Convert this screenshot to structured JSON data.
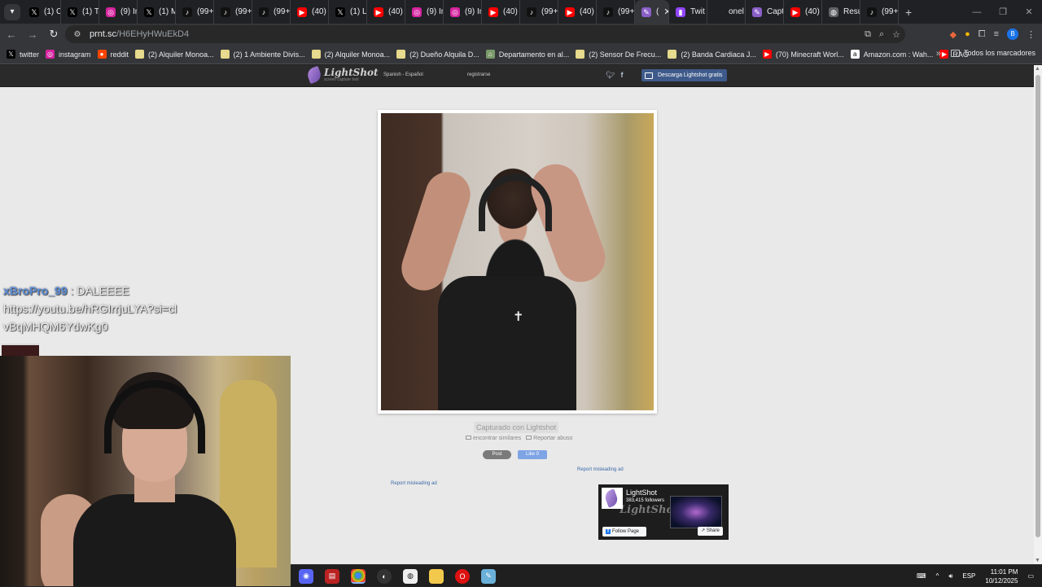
{
  "browser": {
    "tabs": [
      {
        "icon": "x-icon",
        "label": "(1) C"
      },
      {
        "icon": "x-icon",
        "label": "(1) Tr"
      },
      {
        "icon": "instagram-icon",
        "label": "(9) In"
      },
      {
        "icon": "x-icon",
        "label": "(1) M"
      },
      {
        "icon": "tiktok-icon",
        "label": "(99+"
      },
      {
        "icon": "tiktok-icon",
        "label": "(99+"
      },
      {
        "icon": "tiktok-icon",
        "label": "(99+"
      },
      {
        "icon": "youtube-icon",
        "label": "(40)"
      },
      {
        "icon": "x-icon",
        "label": "(1) L"
      },
      {
        "icon": "youtube-icon",
        "label": "(40)"
      },
      {
        "icon": "instagram-icon",
        "label": "(9) In"
      },
      {
        "icon": "instagram-icon",
        "label": "(9) In"
      },
      {
        "icon": "youtube-icon",
        "label": "(40)"
      },
      {
        "icon": "tiktok-icon",
        "label": "(99+"
      },
      {
        "icon": "youtube-icon",
        "label": "(40)"
      },
      {
        "icon": "tiktok-icon",
        "label": "(99+"
      },
      {
        "icon": "lightshot-icon",
        "label": "(",
        "active": true
      },
      {
        "icon": "twitch-icon",
        "label": "Twit"
      },
      {
        "icon": "blank-icon",
        "label": "onel"
      },
      {
        "icon": "lightshot-icon",
        "label": "Capt"
      },
      {
        "icon": "youtube-icon",
        "label": "(40)"
      },
      {
        "icon": "globe-icon",
        "label": "Resu"
      },
      {
        "icon": "tiktok-icon",
        "label": "(99+"
      }
    ],
    "url_host": "prnt.sc",
    "url_path": "/H6EHyHWuEkD4",
    "profile_letter": "B",
    "bookmarks": [
      {
        "icon": "x-icon",
        "label": "twitter",
        "color": "#000000"
      },
      {
        "icon": "instagram-icon",
        "label": "instagram",
        "color": "#d6249f"
      },
      {
        "icon": "reddit-icon",
        "label": "reddit",
        "color": "#ff4500"
      },
      {
        "icon": "site-icon",
        "label": "(2) Alquiler Monoa...",
        "color": "#e6d98a"
      },
      {
        "icon": "site-icon",
        "label": "(2) 1 Ambiente Divis...",
        "color": "#e6d98a"
      },
      {
        "icon": "site-icon",
        "label": "(2) Alquiler Monoa...",
        "color": "#e6d98a"
      },
      {
        "icon": "site-icon",
        "label": "(2) Dueño Alquila D...",
        "color": "#e6d98a"
      },
      {
        "icon": "house-icon",
        "label": "Departamento en al...",
        "color": "#7a9a6a"
      },
      {
        "icon": "site-icon",
        "label": "(2) Sensor De Frecu...",
        "color": "#e6d98a"
      },
      {
        "icon": "site-icon",
        "label": "(2) Banda Cardiaca J...",
        "color": "#e6d98a"
      },
      {
        "icon": "youtube-icon",
        "label": "(70) Minecraft Worl...",
        "color": "#ff0000"
      },
      {
        "icon": "amazon-icon",
        "label": "Amazon.com : Wah...",
        "color": "#ffffff"
      },
      {
        "icon": "youtube-icon",
        "label": "RAG",
        "color": "#ff0000"
      }
    ],
    "all_bookmarks_label": "Todos los marcadores"
  },
  "lightshot": {
    "logo_name": "LightShot",
    "logo_tagline": "screen capture tool",
    "language": "Spanish - Español",
    "register": "registrarse",
    "download_button": "Descarga Lightshot gratis",
    "caption": "Capturado con Lightshot",
    "find_similar": "encontrar similares",
    "report_abuse": "Reportar abuso",
    "post_button": "Post",
    "like_button": "Like 0",
    "report_ad_1": "Report misleading ad",
    "report_ad_2": "Report misleading ad",
    "fb_page_name": "LightShot",
    "fb_followers": "383,415 followers",
    "fb_follow": "Follow Page",
    "fb_share": "Share"
  },
  "stream": {
    "chat_user": "xBroPro_99",
    "chat_sep": ":",
    "chat_message": "DALEEEE",
    "chat_link": "https://youtu.be/hRGIrrjuLYA?si=clvBqMHQM6YdwKg0"
  },
  "taskbar": {
    "apps": [
      "discord-icon",
      "streamlabs-icon",
      "chrome-icon",
      "obs-icon",
      "app-icon",
      "folder-icon",
      "opera-icon",
      "notepad-icon"
    ],
    "language": "ESP",
    "time": "11:01 PM",
    "date": "10/12/2025"
  }
}
